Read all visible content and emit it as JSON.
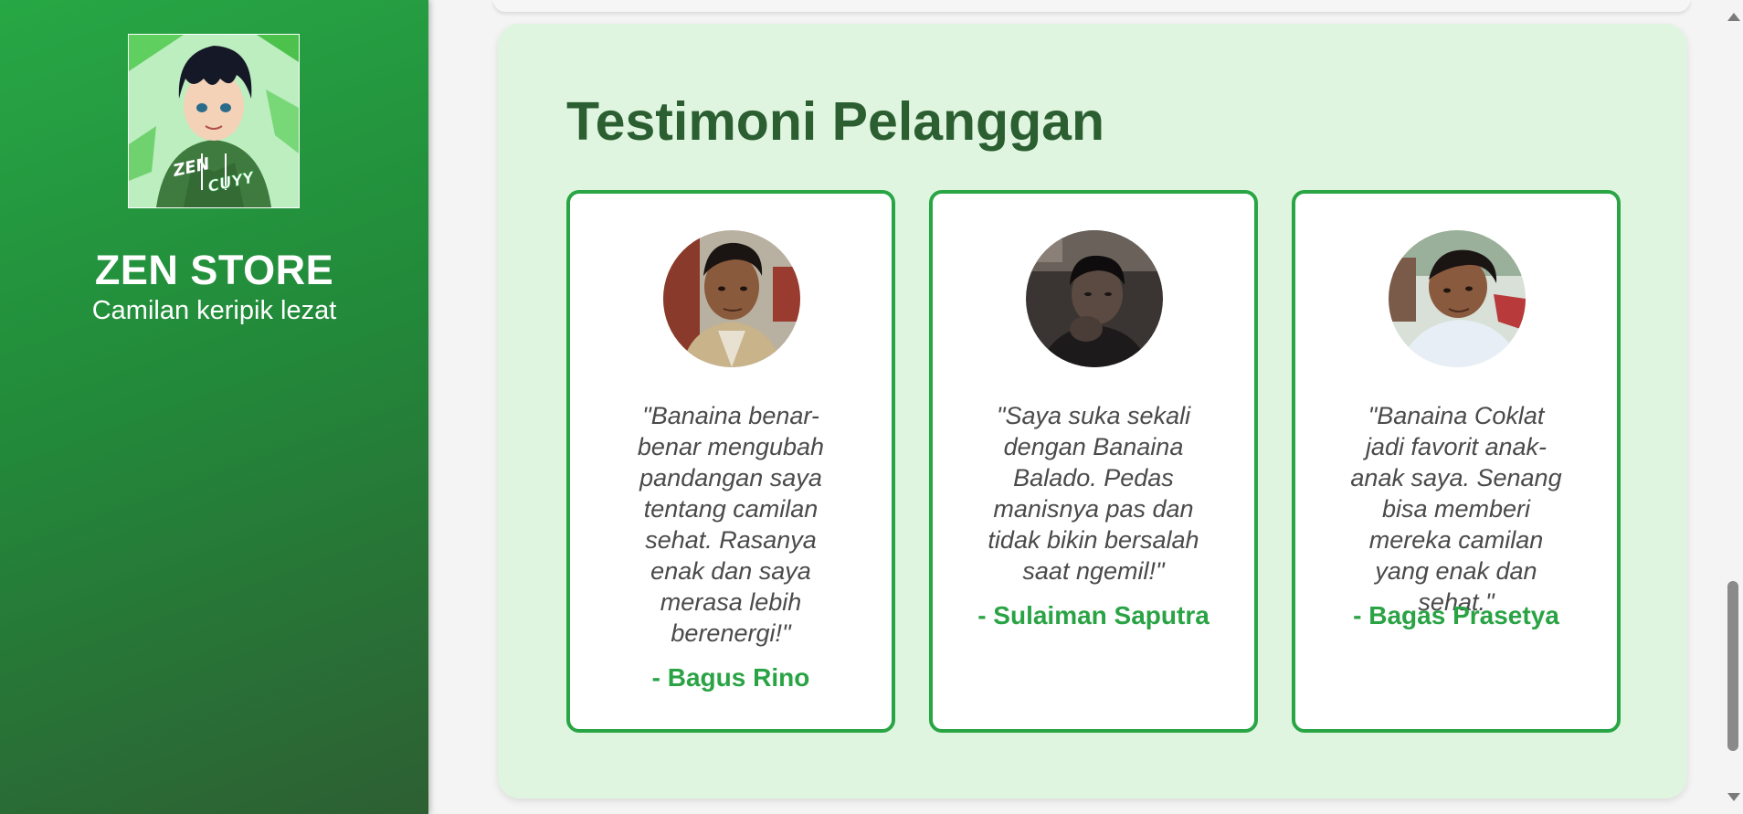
{
  "sidebar": {
    "store_name": "ZEN STORE",
    "tagline": "Camilan keripik lezat",
    "logo": {
      "text_line1": "ZEN",
      "text_line2": "CUYY"
    }
  },
  "testimonials": {
    "title": "Testimoni Pelanggan",
    "items": [
      {
        "quote": "\"Banaina benar-benar mengubah pandangan saya tentang camilan sehat. Rasanya enak dan saya merasa lebih berenergi!\"",
        "author": "- Bagus Rino"
      },
      {
        "quote": "\"Saya suka sekali dengan Banaina Balado. Pedas manisnya pas dan tidak bikin bersalah saat ngemil!\"",
        "author": "- Sulaiman Saputra"
      },
      {
        "quote": "\"Banaina Coklat jadi favorit anak-anak saya. Senang bisa memberi mereka camilan yang enak dan sehat.\"",
        "author": "- Bagas Prasetya"
      }
    ]
  },
  "colors": {
    "brand_green": "#29a545",
    "title_green": "#2b5e31",
    "section_bg": "#dff5df"
  }
}
